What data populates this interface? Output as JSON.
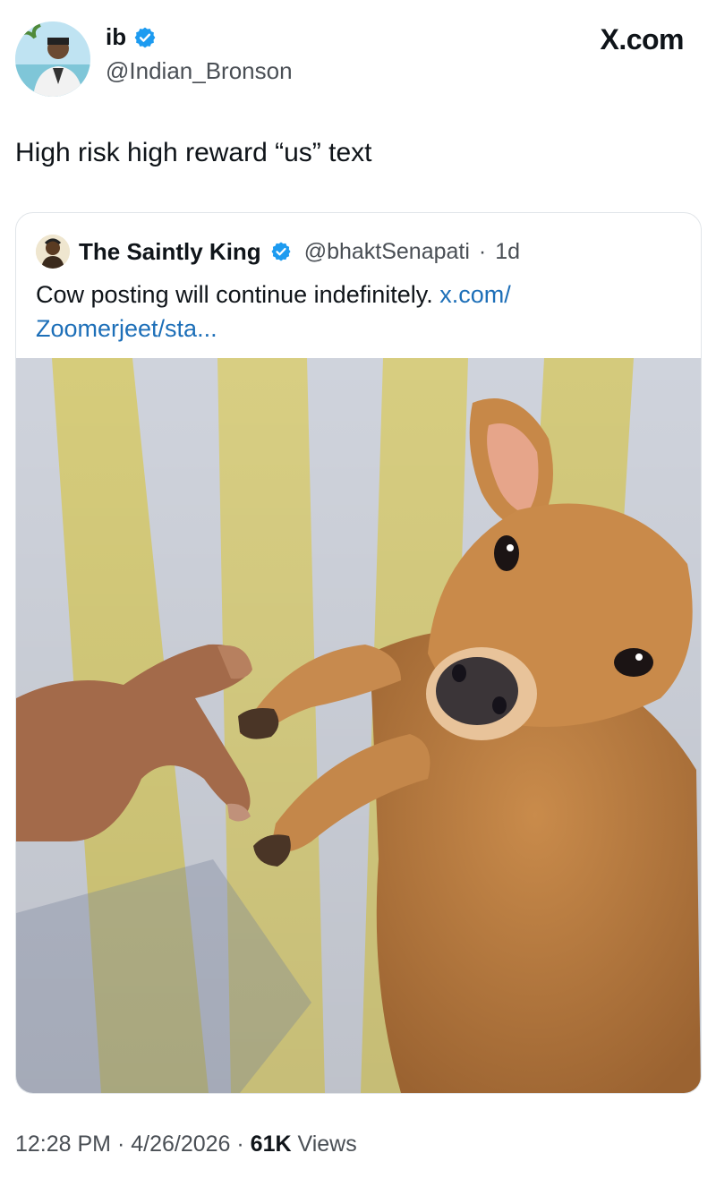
{
  "author": {
    "display_name": "ib",
    "handle": "@Indian_Bronson",
    "verified": true
  },
  "brand": "X.com",
  "tweet": {
    "text": "High risk high reward “us” text"
  },
  "quoted_tweet": {
    "display_name": "The Saintly King",
    "handle": "@bhaktSenapati",
    "separator": "·",
    "age": "1d",
    "text": "Cow posting will continue indefinitely. ",
    "link_line1": "x.com/",
    "link_line2": "Zoomerjeet/sta..."
  },
  "meta": {
    "time": "12:28 PM",
    "separator1": " · ",
    "date": "4/26/2026",
    "separator2": " · ",
    "views_count": "61K",
    "views_label": " Views"
  },
  "colors": {
    "verified_blue": "#1d9bf0",
    "link_blue": "#1d6fb8",
    "stripe_yellow": "#d9cf7e",
    "stripe_white": "#c9cdd6",
    "calf_brown": "#b57a3e"
  },
  "icons": [
    "verified-badge-icon"
  ]
}
